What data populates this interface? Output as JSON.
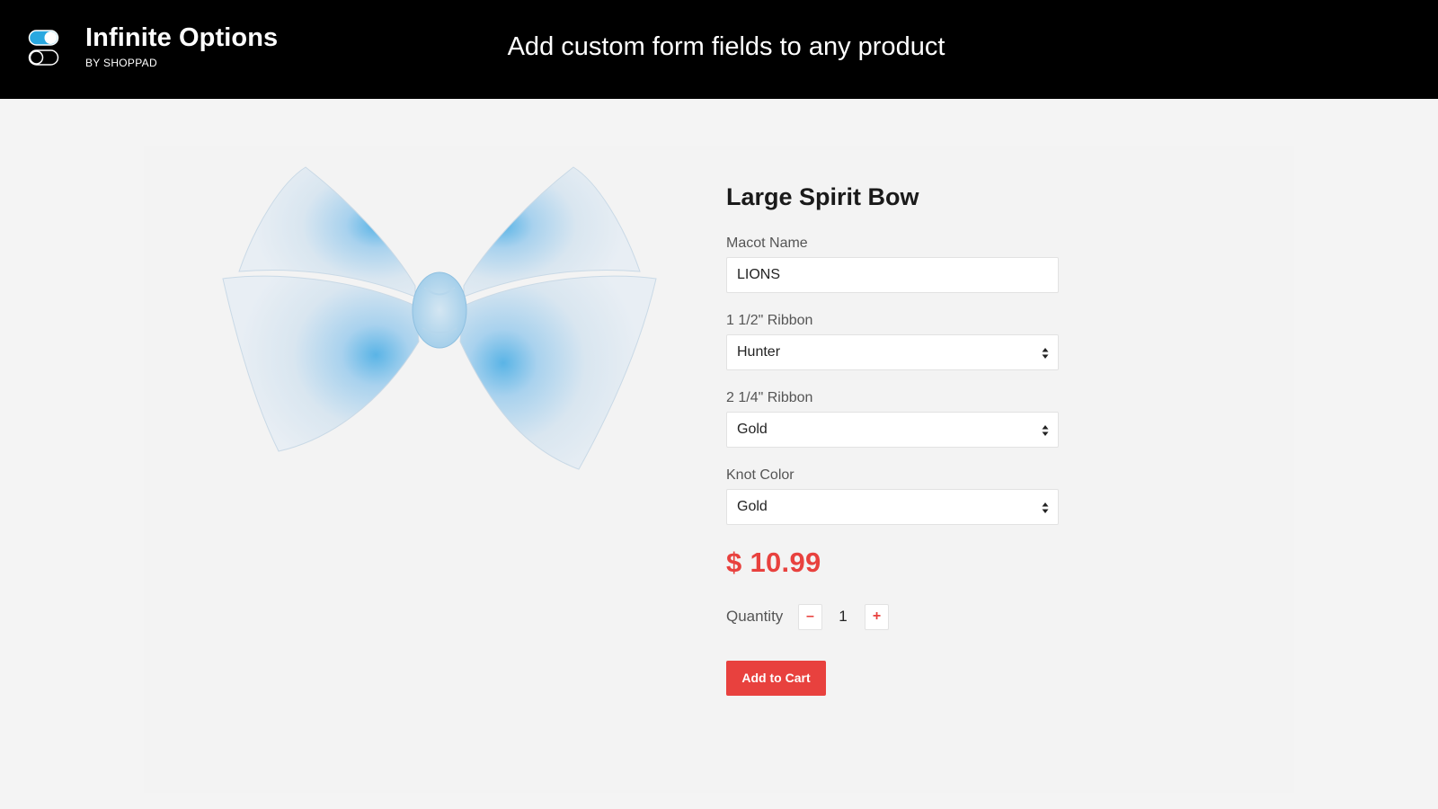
{
  "header": {
    "brand_title": "Infinite Options",
    "brand_subtitle": "BY SHOPPAD",
    "tagline": "Add custom form fields to any product",
    "logo_icon": "toggle-switches-icon",
    "toggle_accent": "#29a8e0"
  },
  "product": {
    "title": "Large Spirit Bow",
    "image_icon": "ribbon-bow-image",
    "fields": [
      {
        "label": "Macot Name",
        "type": "text",
        "value": "LIONS"
      },
      {
        "label": "1 1/2\" Ribbon",
        "type": "select",
        "value": "Hunter"
      },
      {
        "label": "2 1/4\" Ribbon",
        "type": "select",
        "value": "Gold"
      },
      {
        "label": "Knot Color",
        "type": "select",
        "value": "Gold"
      }
    ],
    "price": "$ 10.99",
    "quantity_label": "Quantity",
    "quantity_value": "1",
    "minus_label": "–",
    "plus_label": "+",
    "add_to_cart_label": "Add to Cart"
  },
  "colors": {
    "accent": "#e8413e",
    "header_bg": "#000000",
    "page_bg": "#f4f4f4"
  }
}
